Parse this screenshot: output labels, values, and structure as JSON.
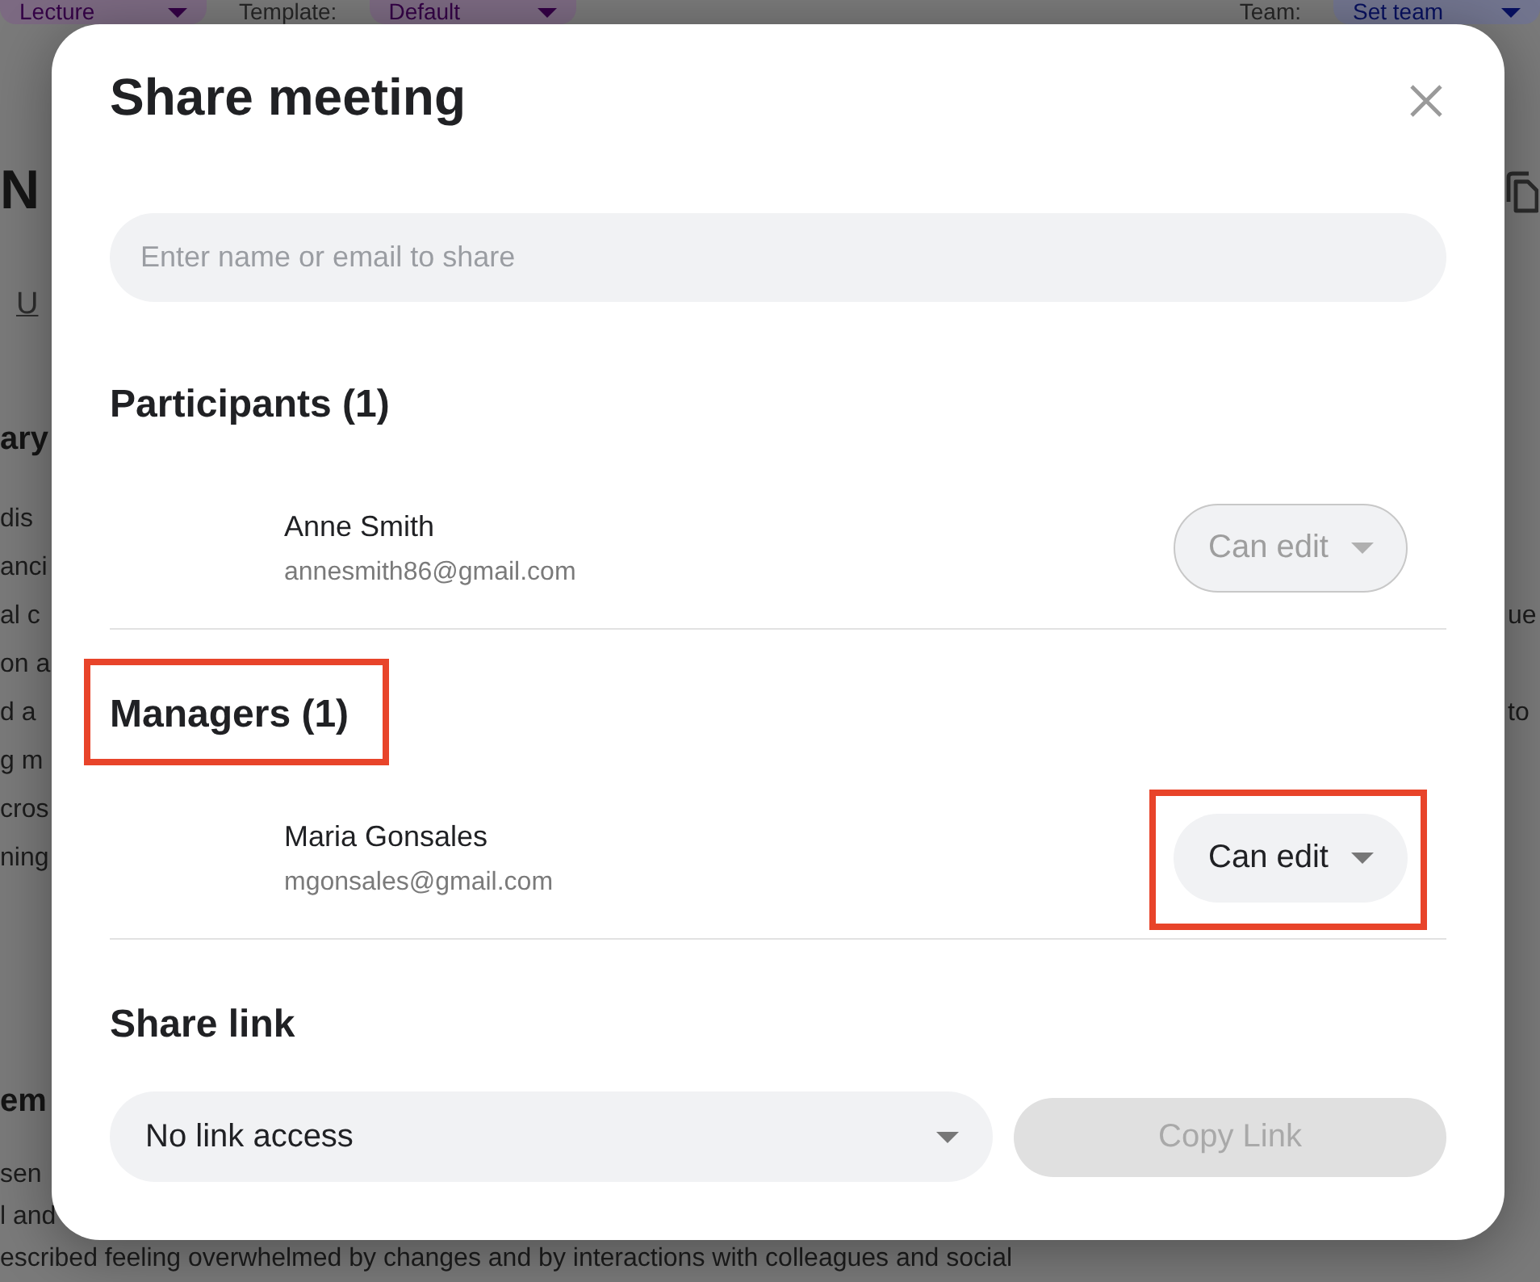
{
  "background": {
    "top_bar": {
      "left": [
        {
          "kind": "dropdown",
          "label": "Lecture",
          "color": "#7c6a82"
        },
        {
          "kind": "label",
          "label": "Template:"
        },
        {
          "kind": "dropdown",
          "label": "Default",
          "color": "#7c6a82"
        }
      ],
      "right": [
        {
          "kind": "label",
          "label": "Team:"
        },
        {
          "kind": "dropdown",
          "label": "Set team",
          "color": "#72758f"
        }
      ]
    },
    "title": "N",
    "format_button": "U",
    "sections": [
      {
        "heading": "ary",
        "lines": [
          "dis",
          "anci",
          "al c",
          "on a",
          "d a",
          "g m",
          "cros",
          "ning"
        ]
      },
      {
        "heading": "em",
        "lines": [
          "sen",
          "l and",
          "escribed feeling overwhelmed by changes and by interactions with colleagues and social"
        ]
      }
    ],
    "right_edge": [
      "ue",
      "to"
    ]
  },
  "dialog": {
    "title": "Share meeting",
    "search": {
      "placeholder": "Enter name or email to share"
    },
    "sections": [
      {
        "title": "Participants (1)",
        "highlighted": false,
        "people": [
          {
            "name": "Anne Smith",
            "email": "annesmith86@gmail.com",
            "role": {
              "label": "Can edit",
              "disabled": true,
              "highlighted": false
            }
          }
        ]
      },
      {
        "title": "Managers (1)",
        "highlighted": true,
        "people": [
          {
            "name": "Maria Gonsales",
            "email": "mgonsales@gmail.com",
            "role": {
              "label": "Can edit",
              "disabled": false,
              "highlighted": true
            }
          }
        ]
      }
    ],
    "share_link": {
      "title": "Share link",
      "access": "No link access",
      "copy_button": {
        "label": "Copy Link",
        "disabled": true
      }
    }
  }
}
